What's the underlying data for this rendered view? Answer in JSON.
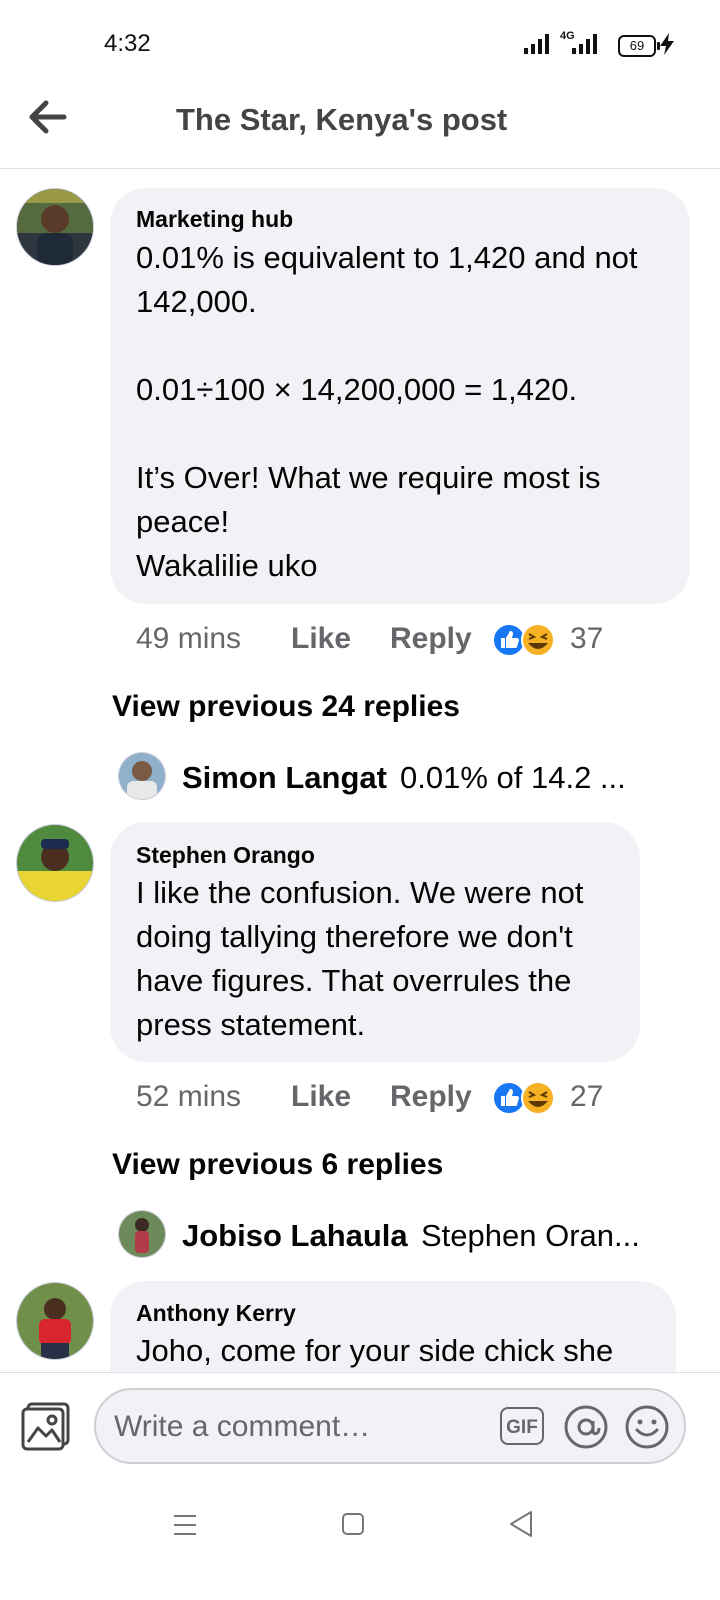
{
  "status": {
    "time": "4:32",
    "network": "4G",
    "battery": "69"
  },
  "header": {
    "title": "The Star, Kenya's post"
  },
  "comments": [
    {
      "author": "Marketing hub",
      "text": "0.01% is equivalent to 1,420 and not 142,000.\n\n0.01÷100 × 14,200,000 = 1,420.\n\nIt’s Over! What we require most is peace!\nWakalilie uko",
      "time": "49 mins",
      "like": "Like",
      "reply": "Reply",
      "reactions": "37",
      "view_previous": "View previous 24 replies",
      "last_reply": {
        "name": "Simon Langat",
        "text": "0.01% of 14.2 ..."
      }
    },
    {
      "author": "Stephen Orango",
      "text": "I like the confusion. We were not doing tallying therefore we don't have figures. That overrules the press statement.",
      "time": "52 mins",
      "like": "Like",
      "reply": "Reply",
      "reactions": "27",
      "view_previous": "View previous 6 replies",
      "last_reply": {
        "name": "Jobiso Lahaula",
        "text": "Stephen Oran..."
      }
    },
    {
      "author": "Anthony Kerry",
      "text": "Joho, come for your side chick she"
    }
  ],
  "composer": {
    "placeholder": "Write a comment…",
    "gif_label": "GIF"
  },
  "icons": {
    "back": "arrow-left-icon",
    "photo": "photo-icon",
    "gif": "gif-icon",
    "mention": "at-icon",
    "emoji": "smiley-icon",
    "like_reaction": "thumbs-up-icon",
    "haha_reaction": "laughing-face-icon"
  },
  "colors": {
    "like_blue": "#1877f2",
    "haha_yellow": "#f7b125",
    "bubble": "#f0f2f5",
    "muted": "#65676b"
  }
}
